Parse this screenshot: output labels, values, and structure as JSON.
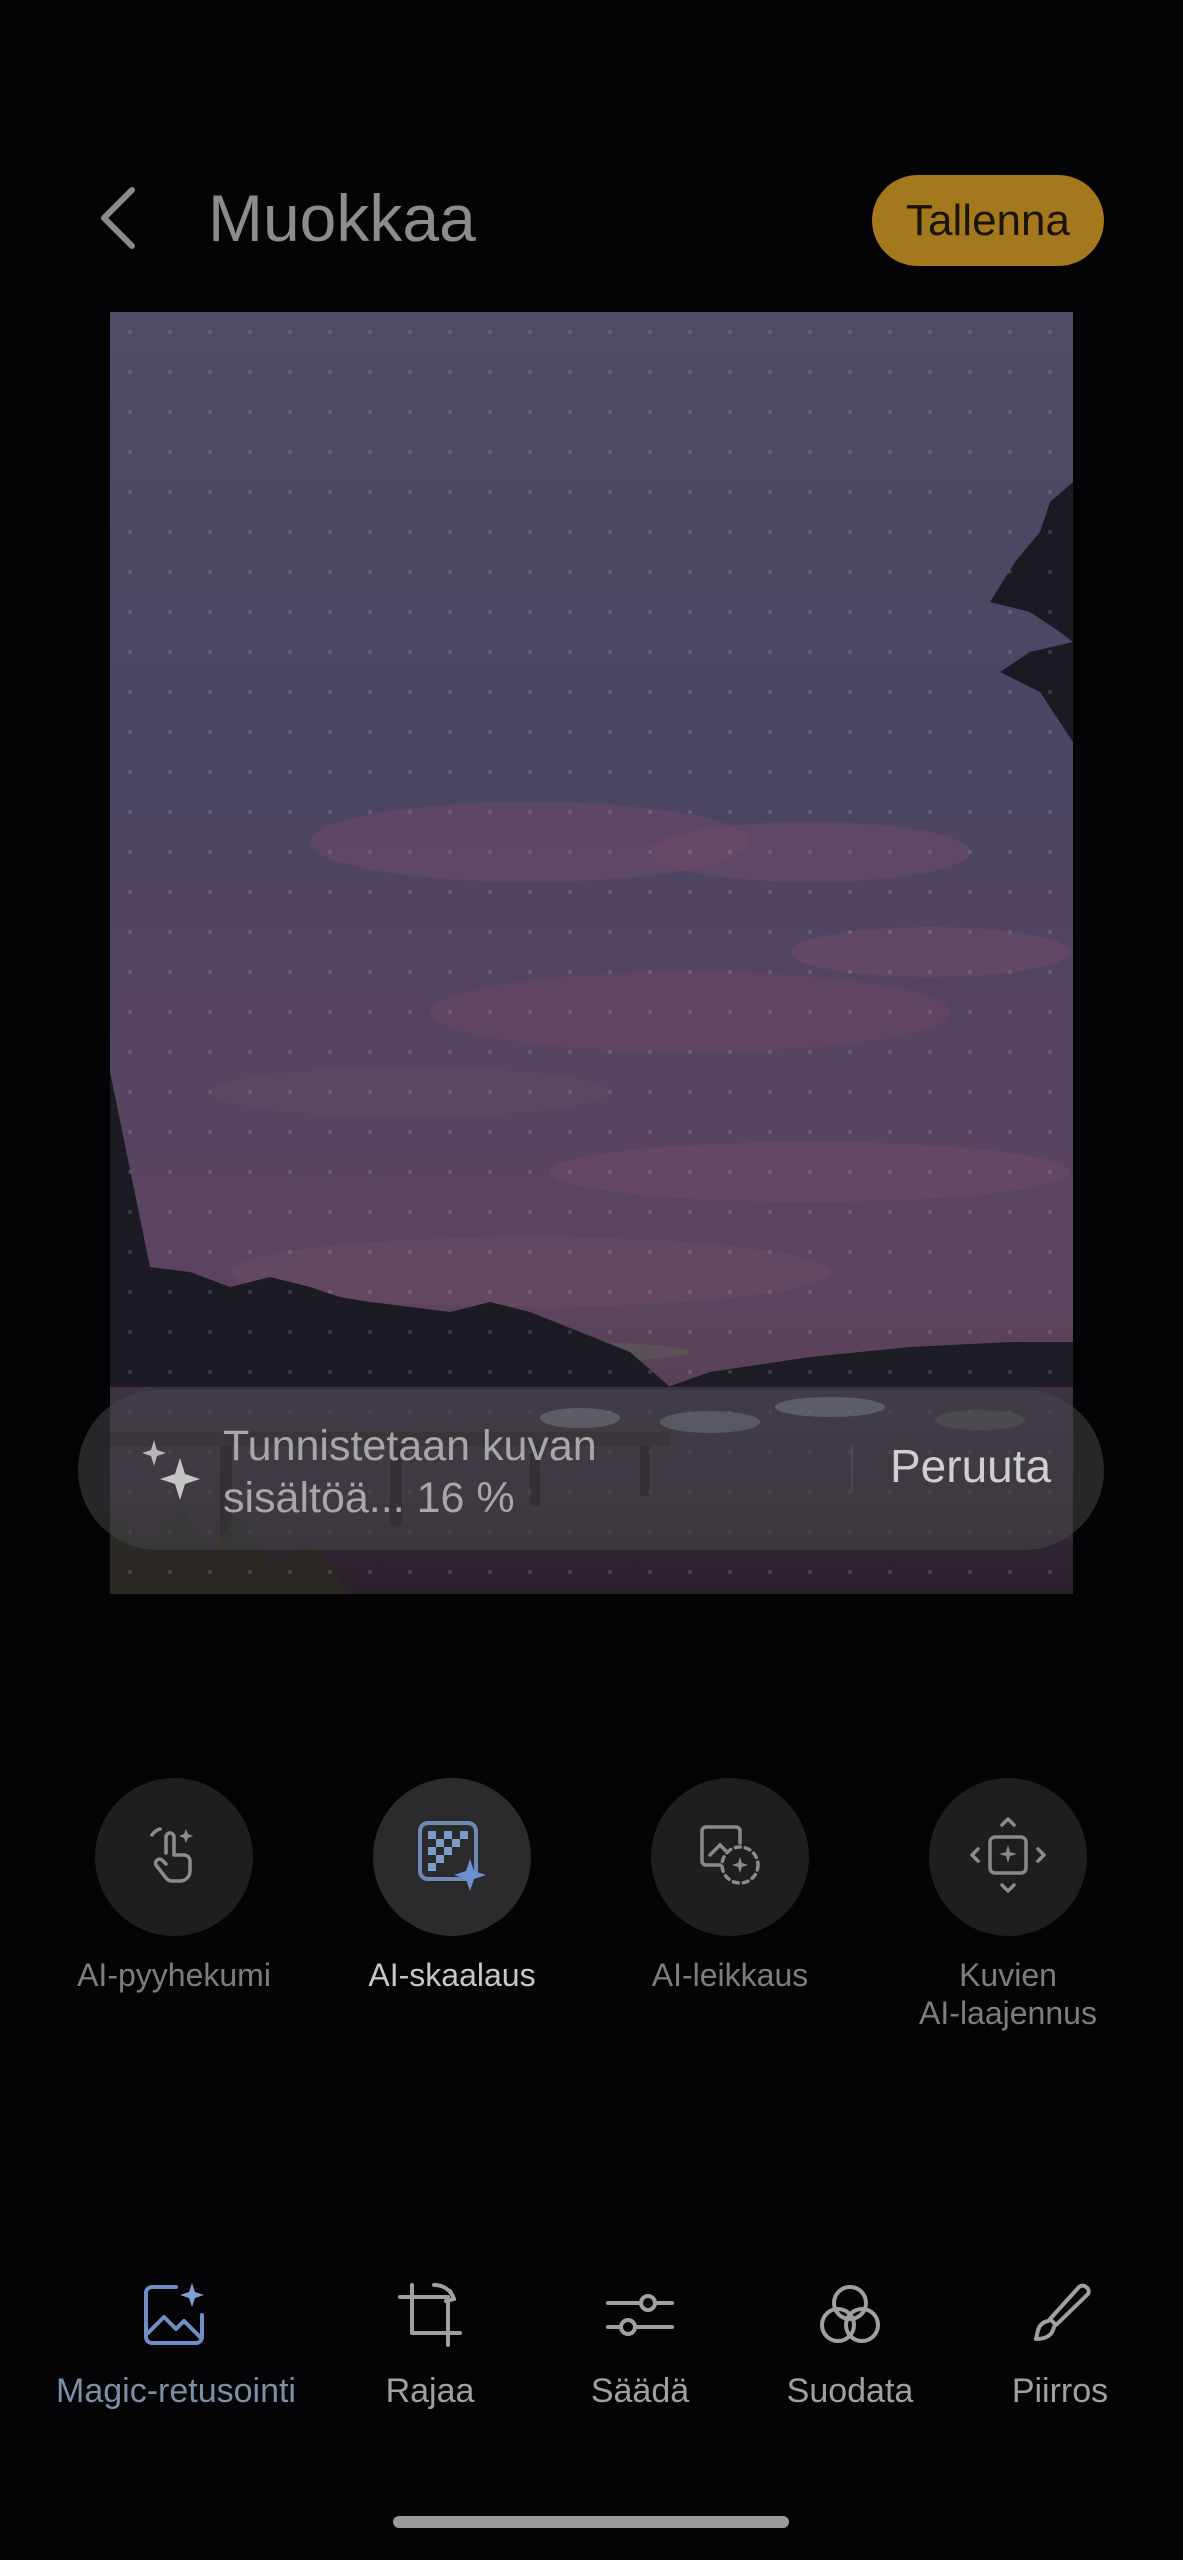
{
  "header": {
    "title": "Muokkaa",
    "save_label": "Tallenna",
    "back_icon": "chevron-left-icon"
  },
  "colors": {
    "accent": "#a4781c",
    "active_nav": "#7c8fa6",
    "background": "#040305"
  },
  "progress": {
    "line1": "Tunnistetaan kuvan",
    "line2": "sisältöä... 16 %",
    "percent": 16,
    "cancel_label": "Peruuta"
  },
  "tools": [
    {
      "label": "AI-pyyhekumi",
      "icon": "touch-sparkle-icon",
      "selected": false
    },
    {
      "label": "AI-skaalaus",
      "icon": "upscale-grid-icon",
      "selected": true
    },
    {
      "label": "AI-leikkaus",
      "icon": "cutout-icon",
      "selected": false
    },
    {
      "label": "Kuvien\nAI-laajennus",
      "icon": "expand-arrows-icon",
      "selected": false
    }
  ],
  "nav": [
    {
      "label": "Magic-retusointi",
      "icon": "magic-image-icon",
      "active": true
    },
    {
      "label": "Rajaa",
      "icon": "crop-icon",
      "active": false
    },
    {
      "label": "Säädä",
      "icon": "sliders-icon",
      "active": false
    },
    {
      "label": "Suodata",
      "icon": "filter-circles-icon",
      "active": false
    },
    {
      "label": "Piirros",
      "icon": "brush-icon",
      "active": false
    }
  ]
}
